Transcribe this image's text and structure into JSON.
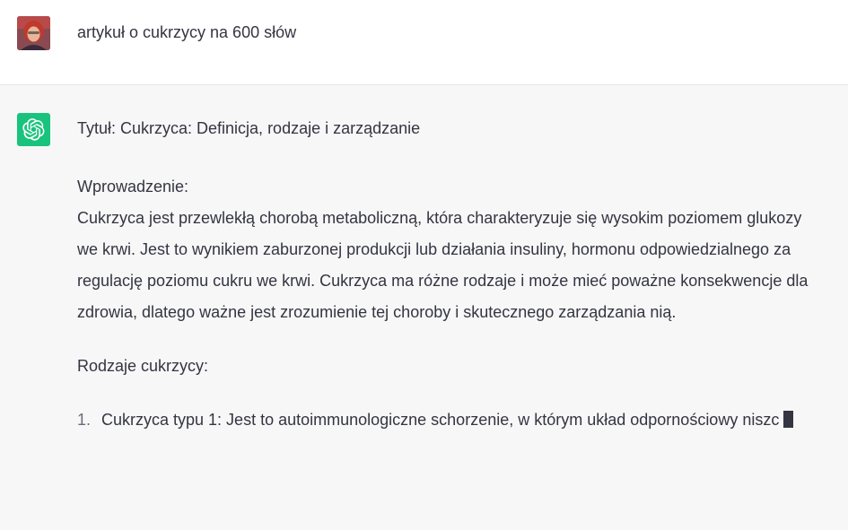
{
  "user_message": {
    "text": "artykuł o cukrzycy na 600 słów",
    "avatar_icon": "user-avatar"
  },
  "assistant_message": {
    "icon": "openai-logo-icon",
    "icon_color": "#19c37d",
    "title": "Tytuł: Cukrzyca: Definicja, rodzaje i zarządzanie",
    "intro_label": "Wprowadzenie:",
    "intro_body": "Cukrzyca jest przewlekłą chorobą metaboliczną, która charakteryzuje się wysokim poziomem glukozy we krwi. Jest to wynikiem zaburzonej produkcji lub działania insuliny, hormonu odpowiedzialnego za regulację poziomu cukru we krwi. Cukrzyca ma różne rodzaje i może mieć poważne konsekwencje dla zdrowia, dlatego ważne jest zrozumienie tej choroby i skutecznego zarządzania nią.",
    "types_label": "Rodzaje cukrzycy:",
    "list": [
      {
        "number": "1.",
        "text": "Cukrzyca typu 1: Jest to autoimmunologiczne schorzenie, w którym układ odpornościowy niszc"
      }
    ]
  }
}
